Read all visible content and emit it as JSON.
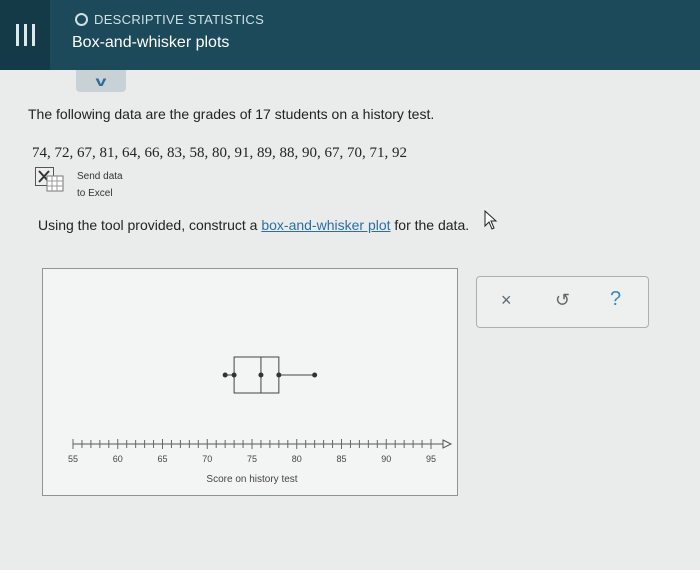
{
  "header": {
    "topic": "DESCRIPTIVE STATISTICS",
    "title": "Box-and-whisker plots"
  },
  "question": {
    "intro": "The following data are the grades of 17 students on a history test.",
    "data_values": "74, 72, 67, 81, 64, 66, 83, 58, 80, 91, 89, 88, 90, 67, 70, 71, 92",
    "excel_line1": "Send data",
    "excel_line2": "to Excel",
    "instruction_before": "Using the tool provided, construct a ",
    "instruction_link": "box-and-whisker plot",
    "instruction_after": " for the data."
  },
  "plot": {
    "axis_label": "Score on history test",
    "ticks": [
      "55",
      "60",
      "65",
      "70",
      "75",
      "80",
      "85",
      "90",
      "95"
    ],
    "axis_min": 55,
    "axis_max": 95,
    "box": {
      "min": 72,
      "q1": 73,
      "median": 76,
      "q3": 78,
      "max": 82
    }
  },
  "tools": {
    "close_symbol": "×",
    "undo_symbol": "↺",
    "help_symbol": "?"
  },
  "colors": {
    "header_bg": "#1d4a5a",
    "link": "#2a6fa8",
    "help": "#3c87c0"
  }
}
